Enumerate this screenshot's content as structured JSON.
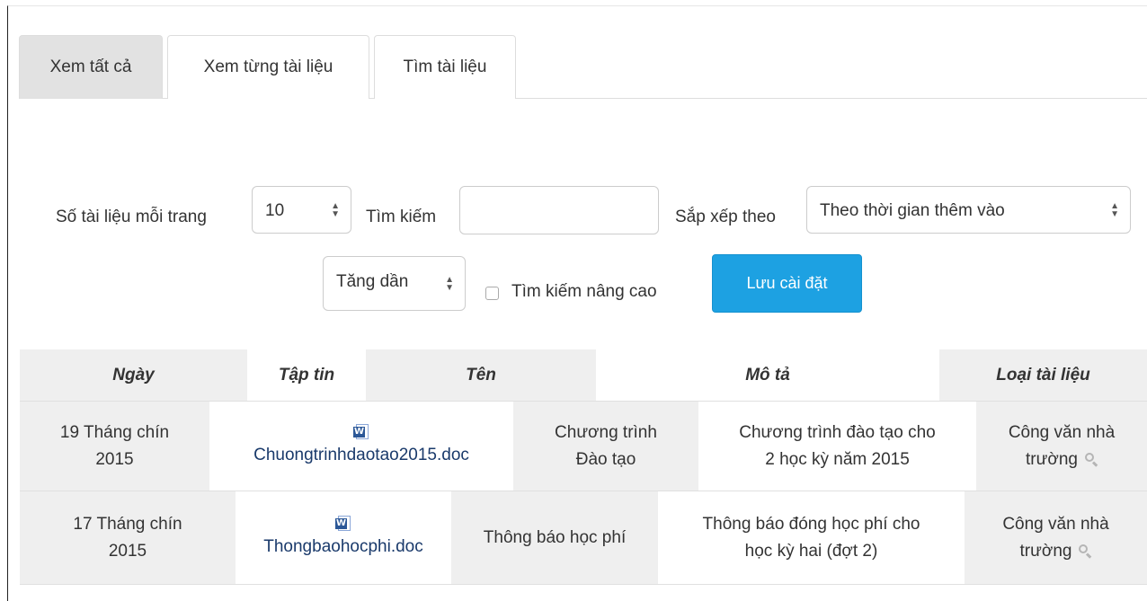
{
  "tabs": [
    {
      "label": "Xem tất cả",
      "active": true
    },
    {
      "label": "Xem từng tài liệu",
      "active": false
    },
    {
      "label": "Tìm tài liệu",
      "active": false
    }
  ],
  "toolbar": {
    "per_page_label": "Số tài liệu mỗi trang",
    "per_page_value": "10",
    "search_label": "Tìm kiếm",
    "search_value": "",
    "sort_label": "Sắp xếp theo",
    "sort_value": "Theo thời gian thêm vào",
    "order_value": "Tăng dần",
    "advanced_search_label": "Tìm kiếm nâng cao",
    "advanced_search_checked": false,
    "save_label": "Lưu cài đặt"
  },
  "table": {
    "headers": [
      "Ngày",
      "Tập tin",
      "Tên",
      "Mô tả",
      "Loại tài liệu"
    ],
    "rows": [
      {
        "date_line1": "19 Tháng chín",
        "date_line2": "2015",
        "file": "Chuongtrinhdaotao2015.doc",
        "name_line1": "Chương trình",
        "name_line2": "Đào tạo",
        "desc_line1": "Chương trình đào tạo cho",
        "desc_line2": "2 học kỳ năm 2015",
        "type_line1": "Công văn nhà",
        "type_line2": "trường"
      },
      {
        "date_line1": "17 Tháng chín",
        "date_line2": "2015",
        "file": "Thongbaohocphi.doc",
        "name_line1": "Thông báo học phí",
        "name_line2": "",
        "desc_line1": "Thông báo đóng học phí cho",
        "desc_line2": "học kỳ hai (đợt 2)",
        "type_line1": "Công văn nhà",
        "type_line2": "trường"
      }
    ]
  },
  "icons": {
    "file_icon": "word-doc-icon",
    "type_icon": "magnifier-icon",
    "select_icon": "updown-caret-icon"
  },
  "colors": {
    "primary_button": "#1da1e2",
    "active_tab": "#e2e2e2",
    "stripe": "#efefef"
  }
}
